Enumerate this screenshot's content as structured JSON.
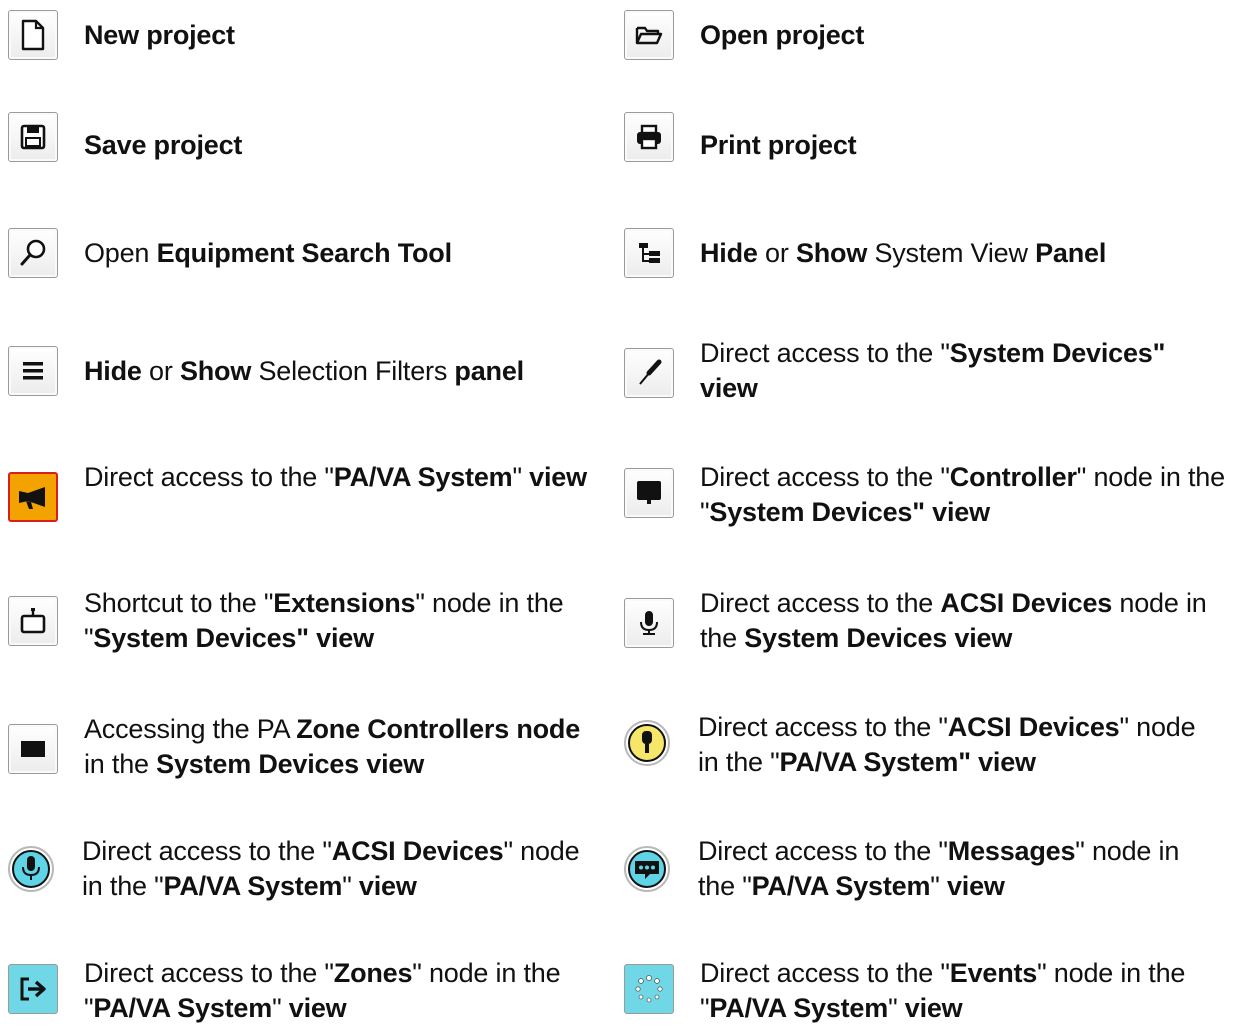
{
  "items": [
    {
      "icon": "new-file-icon",
      "parts": [
        {
          "t": "New project",
          "b": true
        }
      ]
    },
    {
      "icon": "folder-open-icon",
      "parts": [
        {
          "t": "Open project",
          "b": true
        }
      ]
    },
    {
      "icon": "save-floppy-icon",
      "parts": [
        {
          "t": "Save project",
          "b": true
        }
      ]
    },
    {
      "icon": "printer-icon",
      "parts": [
        {
          "t": "Print project",
          "b": true
        }
      ]
    },
    {
      "icon": "magnifier-icon",
      "parts": [
        {
          "t": "Open ",
          "b": false
        },
        {
          "t": "Equipment Search Tool",
          "b": true
        }
      ]
    },
    {
      "icon": "tree-view-icon",
      "parts": [
        {
          "t": "Hide",
          "b": true
        },
        {
          "t": " or ",
          "b": false
        },
        {
          "t": "Show",
          "b": true
        },
        {
          "t": " System View ",
          "b": false
        },
        {
          "t": "Panel",
          "b": true
        }
      ]
    },
    {
      "icon": "filter-lines-icon",
      "parts": [
        {
          "t": "Hide",
          "b": true
        },
        {
          "t": " or ",
          "b": false
        },
        {
          "t": "Show",
          "b": true
        },
        {
          "t": " Selection Filters ",
          "b": false
        },
        {
          "t": "panel",
          "b": true
        }
      ]
    },
    {
      "icon": "screwdriver-icon",
      "parts": [
        {
          "t": "Direct access to the \"",
          "b": false
        },
        {
          "t": "System Devices\" view",
          "b": true
        }
      ]
    },
    {
      "icon": "megaphone-icon",
      "parts": [
        {
          "t": "Direct access to the \"",
          "b": false
        },
        {
          "t": "PA/VA System",
          "b": true
        },
        {
          "t": "\" ",
          "b": false
        },
        {
          "t": "view",
          "b": true
        }
      ]
    },
    {
      "icon": "monitor-icon",
      "parts": [
        {
          "t": "Direct access to the \"",
          "b": false
        },
        {
          "t": "Controller",
          "b": true
        },
        {
          "t": "\" node in the \"",
          "b": false
        },
        {
          "t": "System Devices\" view",
          "b": true
        }
      ]
    },
    {
      "icon": "extension-box-icon",
      "parts": [
        {
          "t": "Shortcut to the \"",
          "b": false
        },
        {
          "t": "Extensions",
          "b": true
        },
        {
          "t": "\" node in the \"",
          "b": false
        },
        {
          "t": "System Devices\" view",
          "b": true
        }
      ]
    },
    {
      "icon": "microphone-square-icon",
      "parts": [
        {
          "t": "Direct access to the ",
          "b": false
        },
        {
          "t": "ACSI Devices",
          "b": true
        },
        {
          "t": " node in the ",
          "b": false
        },
        {
          "t": "System Devices view",
          "b": true
        }
      ]
    },
    {
      "icon": "zone-controller-icon",
      "parts": [
        {
          "t": "Accessing the PA ",
          "b": false
        },
        {
          "t": "Zone Controllers node",
          "b": true
        },
        {
          "t": " in the ",
          "b": false
        },
        {
          "t": "System Devices view",
          "b": true
        }
      ]
    },
    {
      "icon": "yellow-microphone-icon",
      "parts": [
        {
          "t": "Direct access to the \"",
          "b": false
        },
        {
          "t": "ACSI Devices",
          "b": true
        },
        {
          "t": "\" node in the \"",
          "b": false
        },
        {
          "t": "PA/VA System\" view",
          "b": true
        }
      ]
    },
    {
      "icon": "blue-microphone-icon",
      "parts": [
        {
          "t": "Direct access to the \"",
          "b": false
        },
        {
          "t": "ACSI Devices",
          "b": true
        },
        {
          "t": "\" node in the \"",
          "b": false
        },
        {
          "t": "PA/VA System",
          "b": true
        },
        {
          "t": "\" ",
          "b": false
        },
        {
          "t": "view",
          "b": true
        }
      ]
    },
    {
      "icon": "message-bubble-icon",
      "parts": [
        {
          "t": "Direct access to the \"",
          "b": false
        },
        {
          "t": "Messages",
          "b": true
        },
        {
          "t": "\" node in the \"",
          "b": false
        },
        {
          "t": "PA/VA System",
          "b": true
        },
        {
          "t": "\" ",
          "b": false
        },
        {
          "t": "view",
          "b": true
        }
      ]
    },
    {
      "icon": "zone-arrow-icon",
      "parts": [
        {
          "t": "Direct access to the \"",
          "b": false
        },
        {
          "t": "Zones",
          "b": true
        },
        {
          "t": "\" node in the \"",
          "b": false
        },
        {
          "t": "PA/VA System",
          "b": true
        },
        {
          "t": "\" ",
          "b": false
        },
        {
          "t": "view",
          "b": true
        }
      ]
    },
    {
      "icon": "events-spinner-icon",
      "parts": [
        {
          "t": "Direct access to the \"",
          "b": false
        },
        {
          "t": "Events",
          "b": true
        },
        {
          "t": "\" node in the \"",
          "b": false
        },
        {
          "t": "PA/VA System",
          "b": true
        },
        {
          "t": "\" ",
          "b": false
        },
        {
          "t": "view",
          "b": true
        }
      ]
    }
  ]
}
